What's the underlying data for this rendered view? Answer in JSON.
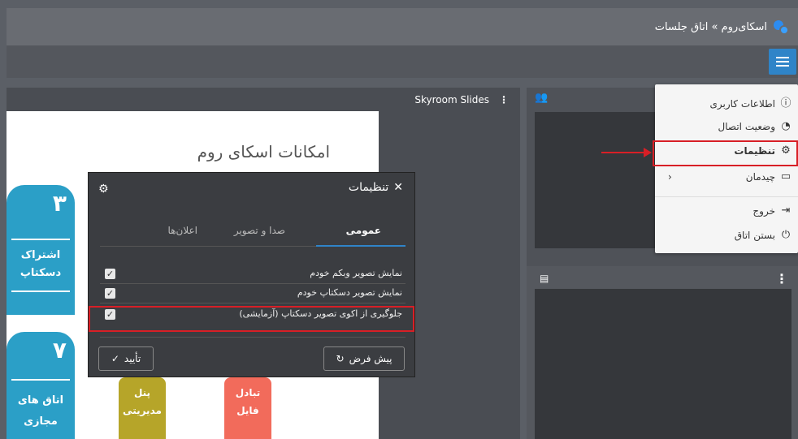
{
  "breadcrumb": "اسکای‌روم » اتاق جلسات",
  "slides": {
    "title": "Skyroom Slides",
    "slide_heading": "امکانات اسکای روم",
    "cards": [
      {
        "num": "۳",
        "label1": "اشتراک",
        "label2": "دسکتاپ"
      },
      {
        "num": "۷",
        "label1": "اتاق های",
        "label2": "مجازی"
      }
    ],
    "tiles": [
      {
        "l1": "پنل",
        "l2": "مدیریتی"
      },
      {
        "l1": "تبادل",
        "l2": "فایل"
      }
    ]
  },
  "menu": {
    "items": [
      {
        "label": "اطلاعات کاربری",
        "icon": "info-icon"
      },
      {
        "label": "وضعیت اتصال",
        "icon": "wifi-icon"
      },
      {
        "label": "تنظیمات",
        "icon": "gear-icon"
      },
      {
        "label": "چیدمان",
        "icon": "layout-icon"
      },
      {
        "label": "خروج",
        "icon": "exit-icon"
      },
      {
        "label": "بستن اتاق",
        "icon": "power-icon"
      }
    ]
  },
  "dialog": {
    "title": "تنظیمات",
    "tabs": [
      "عمومی",
      "صدا و تصویر",
      "اعلان‌ها"
    ],
    "options": [
      {
        "label": "نمایش تصویر وبکم خودم",
        "checked": true
      },
      {
        "label": "نمایش تصویر دسکتاپ خودم",
        "checked": true
      },
      {
        "label": "جلوگیری از اکوی تصویر دسکتاپ (آزمایشی)",
        "checked": true
      }
    ],
    "reset_label": "پیش فرض",
    "confirm_label": "تأیید"
  },
  "colors": {
    "accent": "#2f84c8",
    "highlight": "#d81f26"
  }
}
